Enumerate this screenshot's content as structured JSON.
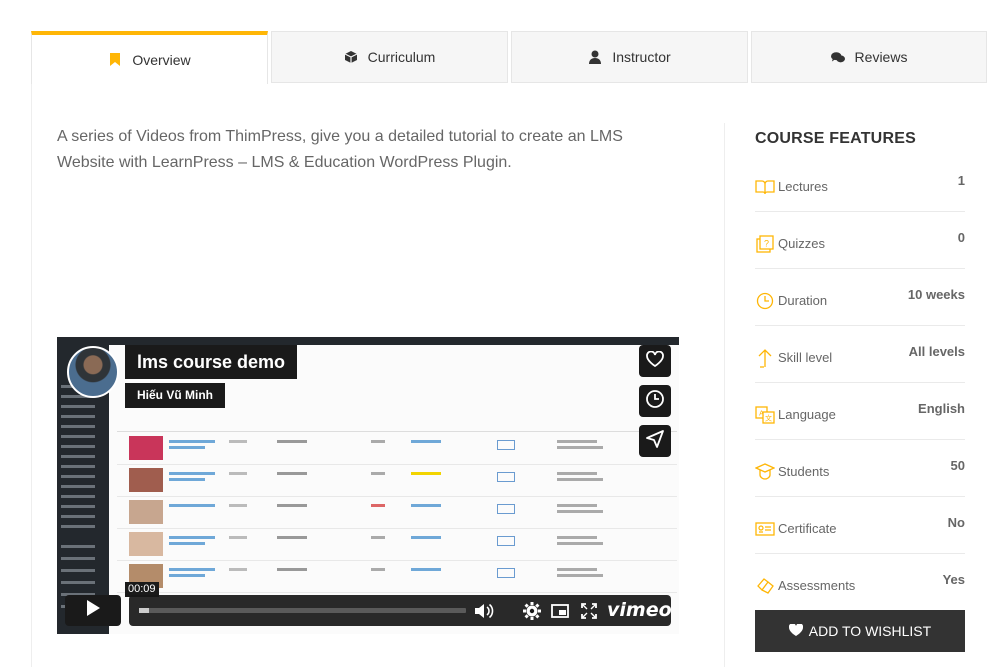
{
  "tabs": [
    {
      "label": "Overview",
      "icon": "bookmark-icon"
    },
    {
      "label": "Curriculum",
      "icon": "cube-icon"
    },
    {
      "label": "Instructor",
      "icon": "user-icon"
    },
    {
      "label": "Reviews",
      "icon": "comments-icon"
    }
  ],
  "overview": {
    "description": "A series of Videos from ThimPress, give you a detailed tutorial to create an LMS Website with LearnPress – LMS & Education WordPress Plugin."
  },
  "video": {
    "title": "lms course demo",
    "author": "Hiếu Vũ Minh",
    "time": "00:09",
    "progress_fraction": 0.03,
    "brand": "vimeo"
  },
  "features": {
    "title": "COURSE FEATURES",
    "items": [
      {
        "label": "Lectures",
        "value": "1",
        "icon": "book-icon"
      },
      {
        "label": "Quizzes",
        "value": "0",
        "icon": "quiz-icon"
      },
      {
        "label": "Duration",
        "value": "10 weeks",
        "icon": "clock-icon"
      },
      {
        "label": "Skill level",
        "value": "All levels",
        "icon": "level-icon"
      },
      {
        "label": "Language",
        "value": "English",
        "icon": "language-icon"
      },
      {
        "label": "Students",
        "value": "50",
        "icon": "students-icon"
      },
      {
        "label": "Certificate",
        "value": "No",
        "icon": "certificate-icon"
      },
      {
        "label": "Assessments",
        "value": "Yes",
        "icon": "assessment-icon"
      }
    ]
  },
  "wishlist": {
    "label": "ADD TO WISHLIST"
  },
  "colors": {
    "accent": "#ffb606",
    "dark": "#333333"
  }
}
